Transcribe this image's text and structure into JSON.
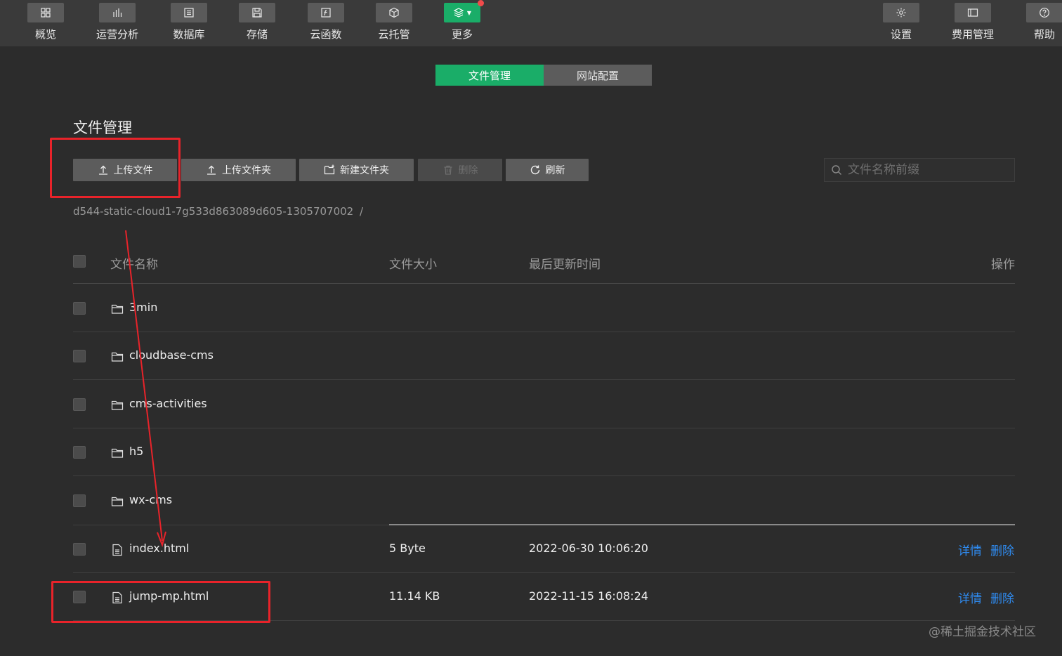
{
  "toolbar": {
    "left": [
      {
        "label": "概览",
        "icon": "grid-icon"
      },
      {
        "label": "运营分析",
        "icon": "bar-chart-icon"
      },
      {
        "label": "数据库",
        "icon": "list-icon"
      },
      {
        "label": "存储",
        "icon": "save-icon"
      },
      {
        "label": "云函数",
        "icon": "function-icon"
      },
      {
        "label": "云托管",
        "icon": "cube-icon"
      },
      {
        "label": "更多",
        "icon": "layers-icon"
      }
    ],
    "right": [
      {
        "label": "设置",
        "icon": "gear-icon"
      },
      {
        "label": "费用管理",
        "icon": "wallet-icon"
      },
      {
        "label": "帮助",
        "icon": "help-icon"
      }
    ],
    "active_color": "#1aad68"
  },
  "tabs": {
    "file_management": "文件管理",
    "site_config": "网站配置"
  },
  "page": {
    "title": "文件管理"
  },
  "actions": {
    "upload_file": "上传文件",
    "upload_folder": "上传文件夹",
    "new_folder": "新建文件夹",
    "delete": "删除",
    "refresh": "刷新"
  },
  "search": {
    "placeholder": "文件名称前缀"
  },
  "path": {
    "bucket": "d544-static-cloud1-7g533d863089d605-1305707002",
    "separator": "/"
  },
  "table": {
    "headers": {
      "name": "文件名称",
      "size": "文件大小",
      "updated": "最后更新时间",
      "ops": "操作"
    },
    "rows": [
      {
        "type": "folder",
        "name": "3min",
        "size": "",
        "time": ""
      },
      {
        "type": "folder",
        "name": "cloudbase-cms",
        "size": "",
        "time": ""
      },
      {
        "type": "folder",
        "name": "cms-activities",
        "size": "",
        "time": ""
      },
      {
        "type": "folder",
        "name": "h5",
        "size": "",
        "time": ""
      },
      {
        "type": "folder",
        "name": "wx-cms",
        "size": "",
        "time": ""
      },
      {
        "type": "file",
        "name": "index.html",
        "size": "5 Byte",
        "time": "2022-06-30 10:06:20",
        "detail": "详情",
        "delete": "删除"
      },
      {
        "type": "file",
        "name": "jump-mp.html",
        "size": "11.14 KB",
        "time": "2022-11-15 16:08:24",
        "detail": "详情",
        "delete": "删除"
      }
    ]
  },
  "watermark": "@稀土掘金技术社区",
  "colors": {
    "accent": "#1aad68",
    "link": "#2f8bf0",
    "annotation": "#e8232a"
  }
}
